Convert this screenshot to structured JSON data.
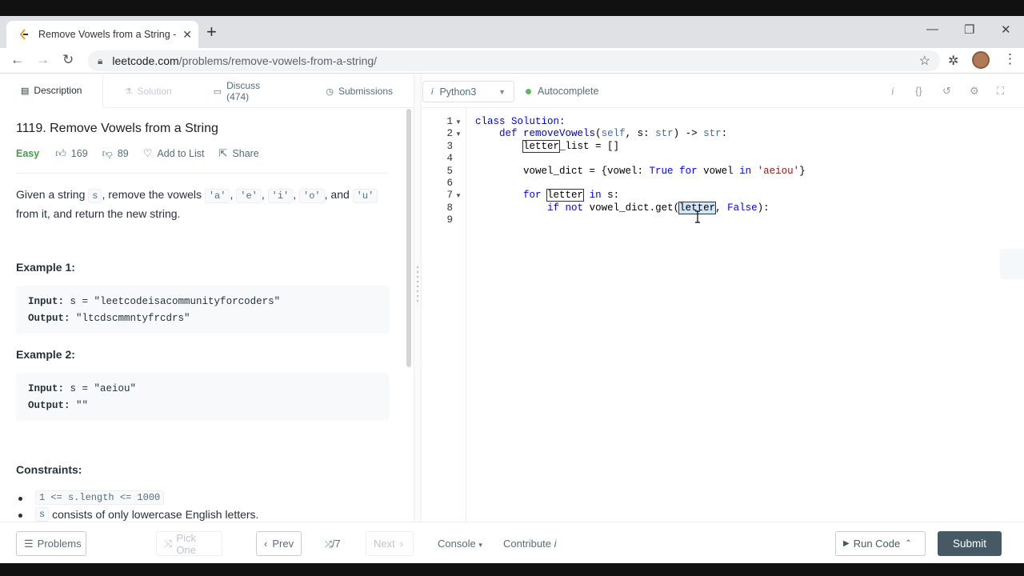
{
  "browser": {
    "tab_title": "Remove Vowels from a String - Le",
    "url_host": "leetcode.com",
    "url_path": "/problems/remove-vowels-from-a-string/"
  },
  "left_tabs": [
    {
      "label": "Description",
      "icon": "document-icon"
    },
    {
      "label": "Solution",
      "icon": "flask-icon"
    },
    {
      "label": "Discuss (474)",
      "icon": "chat-icon"
    },
    {
      "label": "Submissions",
      "icon": "clock-icon"
    }
  ],
  "problem": {
    "title": "1119. Remove Vowels from a String",
    "difficulty": "Easy",
    "likes": "169",
    "dislikes": "89",
    "add_to_list": "Add to List",
    "share": "Share",
    "desc_1": "Given a string",
    "desc_s": "s",
    "desc_2": ", remove the vowels",
    "v_a": "'a'",
    "v_e": "'e'",
    "v_i": "'i'",
    "v_o": "'o'",
    "desc_and": ", and",
    "v_u": "'u'",
    "desc_3": "from it, and return the new string.",
    "comma": ",",
    "example1_title": "Example 1:",
    "example1_input_label": "Input:",
    "example1_input": "s = \"leetcodeisacommunityforcoders\"",
    "example1_output_label": "Output:",
    "example1_output": "\"ltcdscmmntyfrcdrs\"",
    "example2_title": "Example 2:",
    "example2_input_label": "Input:",
    "example2_input": "s = \"aeiou\"",
    "example2_output_label": "Output:",
    "example2_output": "\"\"",
    "constraints_title": "Constraints:",
    "constraint1": "1 <= s.length <= 1000",
    "constraint2_code": "s",
    "constraint2_text": "consists of only lowercase English letters."
  },
  "editor": {
    "language": "Python3",
    "autocomplete": "Autocomplete",
    "line_numbers": [
      "1",
      "2",
      "3",
      "4",
      "5",
      "6",
      "7",
      "8",
      "9"
    ],
    "code": {
      "l1_kw": "class",
      "l1_name": " Solution:",
      "l2_kw": "def",
      "l2_fn": "removeVowels",
      "l2_p1": "(",
      "l2_self": "self",
      "l2_p2": ", s: ",
      "l2_str1": "str",
      "l2_p3": ") -> ",
      "l2_str2": "str",
      "l2_p4": ":",
      "l3_a": "letter",
      "l3_b": "_list = []",
      "l5_a": "vowel_dict = {vowel: ",
      "l5_true": "True",
      "l5_for": "for",
      "l5_b": " vowel ",
      "l5_in": "in",
      "l5_str": "'aeiou'",
      "l5_c": "}",
      "l7_for": "for",
      "l7_var": "letter",
      "l7_in": "in",
      "l7_b": " s:",
      "l8_if": "if",
      "l8_not": "not",
      "l8_a": " vowel_dict.get(",
      "l8_var": "letter",
      "l8_b": ", ",
      "l8_false": "False",
      "l8_c": "):"
    }
  },
  "footer": {
    "problems": "Problems",
    "pick_one": "Pick One",
    "prev": "Prev",
    "page": "/7",
    "next": "Next",
    "console": "Console",
    "contribute": "Contribute",
    "run_code": "Run Code",
    "submit": "Submit"
  }
}
